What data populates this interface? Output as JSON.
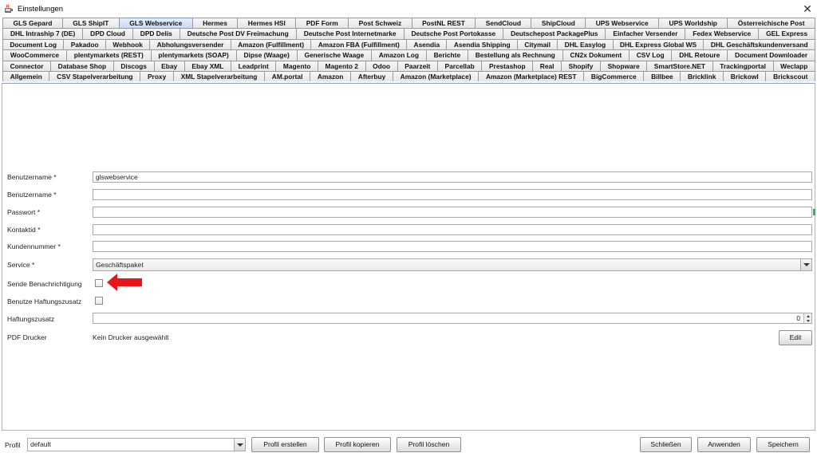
{
  "window": {
    "title": "Einstellungen",
    "close_glyph": "✕",
    "icon": "java-app-icon"
  },
  "tabs": {
    "rows": [
      [
        "GLS Gepard",
        "GLS ShipIT",
        "GLS Webservice",
        "Hermes",
        "Hermes HSI",
        "PDF Form",
        "Post Schweiz",
        "PostNL REST",
        "SendCloud",
        "ShipCloud",
        "UPS Webservice",
        "UPS Worldship",
        "Österreichische Post"
      ],
      [
        "DHL Intraship 7 (DE)",
        "DPD Cloud",
        "DPD Delis",
        "Deutsche Post DV Freimachung",
        "Deutsche Post Internetmarke",
        "Deutsche Post Portokasse",
        "Deutschepost PackagePlus",
        "Einfacher Versender",
        "Fedex Webservice",
        "GEL Express"
      ],
      [
        "Document Log",
        "Pakadoo",
        "Webhook",
        "Abholungsversender",
        "Amazon (Fulfillment)",
        "Amazon FBA (Fulfillment)",
        "Asendia",
        "Asendia Shipping",
        "Citymail",
        "DHL Easylog",
        "DHL Express Global WS",
        "DHL Geschäftskundenversand"
      ],
      [
        "WooCommerce",
        "plentymarkets (REST)",
        "plentymarkets (SOAP)",
        "Dipse (Waage)",
        "Generische Waage",
        "Amazon Log",
        "Berichte",
        "Bestellung als Rechnung",
        "CN2x Dokument",
        "CSV Log",
        "DHL Retoure",
        "Document Downloader"
      ],
      [
        "Connector",
        "Database Shop",
        "Discogs",
        "Ebay",
        "Ebay XML",
        "Leadprint",
        "Magento",
        "Magento 2",
        "Odoo",
        "Paarzeit",
        "Parcellab",
        "Prestashop",
        "Real",
        "Shopify",
        "Shopware",
        "SmartStore.NET",
        "Trackingportal",
        "Weclapp"
      ],
      [
        "Allgemein",
        "CSV Stapelverarbeitung",
        "Proxy",
        "XML Stapelverarbeitung",
        "AM.portal",
        "Amazon",
        "Afterbuy",
        "Amazon (Marketplace)",
        "Amazon (Marketplace) REST",
        "BigCommerce",
        "Billbee",
        "Bricklink",
        "Brickowl",
        "Brickscout"
      ]
    ],
    "active": "GLS Webservice"
  },
  "form": {
    "benutzername1": {
      "label": "Benutzername *",
      "value": "glswebservice"
    },
    "benutzername2": {
      "label": "Benutzername *",
      "value": ""
    },
    "passwort": {
      "label": "Passwort *",
      "value": ""
    },
    "kontaktid": {
      "label": "Kontaktid *",
      "value": ""
    },
    "kundennummer": {
      "label": "Kundennummer *",
      "value": ""
    },
    "service": {
      "label": "Service *",
      "value": "Geschäftspaket"
    },
    "sende_benachrichtigung": {
      "label": "Sende Benachrichtigung",
      "checked": false
    },
    "benutze_haftungszusatz": {
      "label": "Benutze Haftungszusatz",
      "checked": false
    },
    "haftungszusatz": {
      "label": "Haftungszusatz",
      "value": "0"
    },
    "pdf_drucker": {
      "label": "PDF Drucker",
      "value": "Kein Drucker ausgewählt",
      "edit_label": "Edit"
    }
  },
  "annotation": {
    "arrow_color": "#e8151b"
  },
  "bottom": {
    "profil_label": "Profil",
    "profil_value": "default",
    "buttons": {
      "profil_erstellen": "Profil erstellen",
      "profil_kopieren": "Profil kopieren",
      "profil_loeschen": "Profil löschen",
      "schliessen": "Schließen",
      "anwenden": "Anwenden",
      "speichern": "Speichern"
    }
  }
}
